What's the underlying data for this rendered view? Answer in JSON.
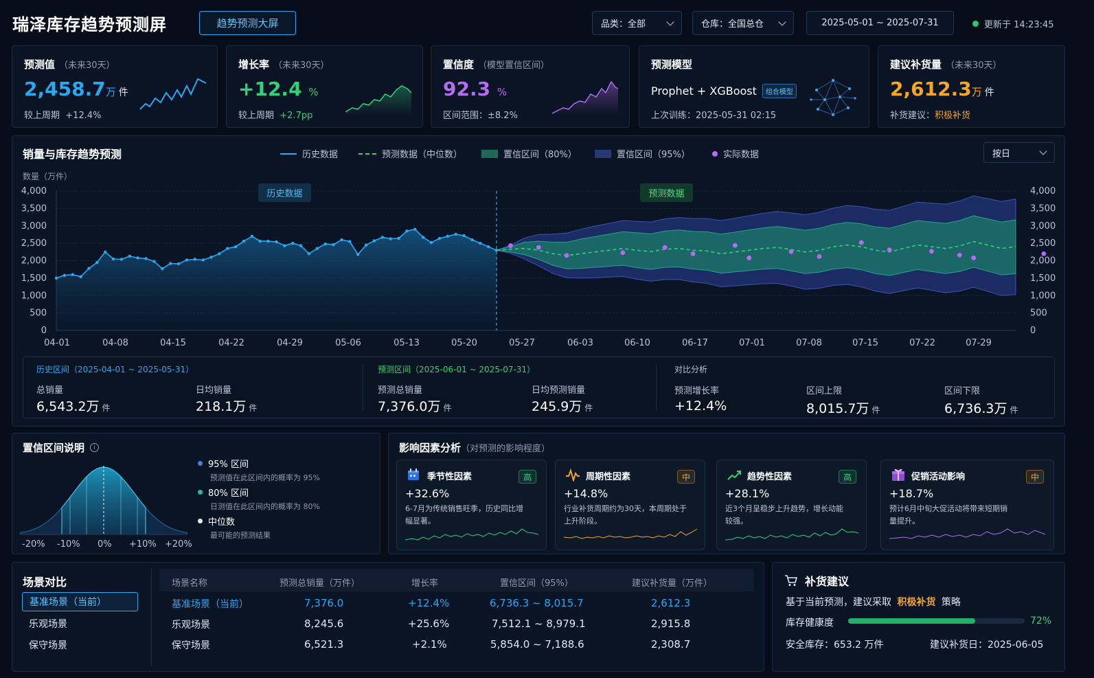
{
  "header": {
    "title": "瑞泽库存趋势预测屏",
    "badge": "趋势预测大屏",
    "category_select": "品类：全部",
    "warehouse_select": "仓库：全国总仓",
    "date_range": "2025-05-01 ~ 2025-07-31",
    "updated": "更新于 14:23:45"
  },
  "kpis": [
    {
      "title": "预测值",
      "sub": "（未来30天）",
      "value": "2,458.7",
      "unit": "万",
      "unit2": "件",
      "foot_label": "较上周期",
      "foot_value": "+12.4%"
    },
    {
      "title": "增长率",
      "sub": "（未来30天）",
      "value": "+12.4",
      "unit": "%",
      "foot_label": "较上周期",
      "foot_value": "+2.7pp"
    },
    {
      "title": "置信度",
      "sub": "（模型置信区间）",
      "value": "92.3",
      "unit": "%",
      "foot_label": "区间范围：",
      "foot_value": "±8.2%"
    },
    {
      "title": "预测模型",
      "model": "Prophet + XGBoost",
      "model_badge": "组合模型",
      "foot_label": "上次训练：",
      "foot_value": "2025-05-31 02:15"
    },
    {
      "title": "建议补货量",
      "sub": "（未来30天）",
      "value": "2,612.3",
      "unit": "万",
      "unit2": "件",
      "foot_label": "补货建议：",
      "foot_value": "积极补货"
    }
  ],
  "chart": {
    "title": "销量与库存趋势预测",
    "y_unit": "数量（万件）",
    "legend": [
      "历史数据",
      "预测数据（中位数）",
      "置信区间（80%）",
      "置信区间（95%）",
      "实际数据"
    ],
    "granularity": "按日",
    "tag_history": "历史数据",
    "tag_forecast": "预测数据"
  },
  "chart_data": {
    "type": "line",
    "x_ticks": [
      "04-01",
      "04-08",
      "04-15",
      "04-22",
      "04-29",
      "05-06",
      "05-13",
      "05-20",
      "05-27",
      "06-03",
      "06-10",
      "06-17",
      "07-01",
      "07-08",
      "07-15",
      "07-22",
      "07-29"
    ],
    "ylim": [
      0,
      4000
    ],
    "y_ticks": [
      0,
      500,
      "1,000",
      "1,500",
      "2,000",
      "2,500",
      "3,000",
      "3,500",
      "4,000"
    ],
    "history": [
      1500,
      1580,
      1600,
      1540,
      1780,
      1950,
      2250,
      2050,
      2040,
      2130,
      2080,
      2060,
      1980,
      1770,
      1920,
      1910,
      2020,
      2040,
      2020,
      2100,
      2200,
      2350,
      2400,
      2560,
      2700,
      2560,
      2560,
      2540,
      2430,
      2500,
      2430,
      2200,
      2350,
      2480,
      2460,
      2600,
      2550,
      2180,
      2450,
      2570,
      2670,
      2630,
      2640,
      2850,
      2900,
      2670,
      2520,
      2640,
      2700,
      2760,
      2720,
      2600,
      2500,
      2400,
      2300
    ],
    "forecast_median": [
      2300,
      2330,
      2350,
      2300,
      2200,
      2150,
      2200,
      2250,
      2300,
      2350,
      2300,
      2260,
      2330,
      2350,
      2300,
      2280,
      2200,
      2250,
      2300,
      2350,
      2380,
      2320,
      2250,
      2300,
      2400,
      2450,
      2400,
      2300,
      2250,
      2350,
      2450,
      2400,
      2350,
      2420,
      2550,
      2450,
      2350,
      2400
    ],
    "ci80_half": [
      0,
      80,
      180,
      260,
      330,
      380,
      420,
      440,
      460,
      480,
      500,
      510,
      520,
      530,
      540,
      550,
      560,
      570,
      580,
      590,
      600,
      610,
      620,
      630,
      640,
      650,
      660,
      670,
      680,
      690,
      700,
      710,
      720,
      730,
      740,
      750,
      760,
      770
    ],
    "ci95_half": [
      0,
      120,
      300,
      450,
      560,
      640,
      700,
      740,
      770,
      800,
      830,
      850,
      870,
      890,
      910,
      930,
      950,
      970,
      990,
      1010,
      1030,
      1050,
      1070,
      1090,
      1110,
      1130,
      1150,
      1170,
      1190,
      1210,
      1230,
      1250,
      1270,
      1290,
      1310,
      1330,
      1350,
      1370
    ],
    "actual": [
      [
        1,
        2430
      ],
      [
        3,
        2380
      ],
      [
        5,
        2150
      ],
      [
        9,
        2230
      ],
      [
        12,
        2380
      ],
      [
        14,
        2200
      ],
      [
        17,
        2440
      ],
      [
        18,
        2080
      ],
      [
        21,
        2260
      ],
      [
        23,
        2120
      ],
      [
        26,
        2520
      ],
      [
        28,
        2310
      ],
      [
        31,
        2270
      ],
      [
        33,
        2160
      ],
      [
        34,
        2080
      ],
      [
        39,
        2200
      ],
      [
        42,
        1710
      ],
      [
        46,
        2480
      ],
      [
        48,
        2050
      ],
      [
        52,
        2020
      ],
      [
        53,
        1890
      ],
      [
        55,
        2260
      ],
      [
        56,
        2140
      ]
    ]
  },
  "summary": {
    "history_title": "历史区间（2025-04-01 ~ 2025-05-31）",
    "history_total_label": "总销量",
    "history_total": "6,543.2万",
    "unit": "件",
    "history_daily_label": "日均销量",
    "history_daily": "218.1万",
    "forecast_title": "预测区间（2025-06-01 ~ 2025-07-31）",
    "forecast_total_label": "预测总销量",
    "forecast_total": "7,376.0万",
    "forecast_daily_label": "日均预测销量",
    "forecast_daily": "245.9万",
    "compare_title": "对比分析",
    "growth_label": "预测增长率",
    "growth": "+12.4%",
    "upper_label": "区间上限",
    "upper": "8,015.7万",
    "lower_label": "区间下限",
    "lower": "6,736.3万"
  },
  "confidence": {
    "title": "置信区间说明",
    "items": [
      {
        "label": "95% 区间",
        "desc": "预测值在此区间内的概率为 95%",
        "color": "#4a7de0"
      },
      {
        "label": "80% 区间",
        "desc": "日测值在此区间内的概率为 80%",
        "color": "#22c08a"
      },
      {
        "label": "中位数",
        "desc": "最可能的预测结果",
        "color": "#d4f5e6"
      }
    ],
    "x_ticks": [
      "-20%",
      "-10%",
      "0%",
      "+10%",
      "+20%"
    ]
  },
  "factors": {
    "title": "影响因素分析",
    "sub": "（对预测的影响程度）",
    "items": [
      {
        "name": "季节性因素",
        "level": "高",
        "value": "+32.6%",
        "desc": "6-7月为传统销售旺季，历史同比增幅显著。",
        "color": "#33d17a",
        "icon": "calendar-icon"
      },
      {
        "name": "周期性因素",
        "level": "中",
        "value": "+14.8%",
        "desc": "行业补货周期约为30天，本周期处于上升阶段。",
        "color": "#f5a623",
        "icon": "pulse-icon"
      },
      {
        "name": "趋势性因素",
        "level": "高",
        "value": "+28.1%",
        "desc": "近3个月呈稳步上升趋势，增长动能较强。",
        "color": "#33d17a",
        "icon": "trend-icon"
      },
      {
        "name": "促销活动影响",
        "level": "中",
        "value": "+18.7%",
        "desc": "预计6月中旬大促活动将带来短期销量提升。",
        "color": "#b46cf0",
        "icon": "gift-icon"
      }
    ]
  },
  "scenarios": {
    "title": "场景对比",
    "tabs": [
      "基准场景（当前）",
      "乐观场景",
      "保守场景"
    ],
    "columns": [
      "场景名称",
      "预测总销量（万件）",
      "增长率",
      "置信区间（95%）",
      "建议补货量（万件）"
    ],
    "rows": [
      [
        "基准场景（当前）",
        "7,376.0",
        "+12.4%",
        "6,736.3 ~ 8,015.7",
        "2,612.3"
      ],
      [
        "乐观场景",
        "8,245.6",
        "+25.6%",
        "7,512.1 ~ 8,979.1",
        "2,915.8"
      ],
      [
        "保守场景",
        "6,521.3",
        "+2.1%",
        "5,854.0 ~ 7,188.6",
        "2,308.7"
      ]
    ]
  },
  "replenish": {
    "title": "补货建议",
    "text_prefix": "基于当前预测，建议采取",
    "text_strong": "积极补货",
    "text_suffix": "策略",
    "health_label": "库存健康度",
    "health_pct": "72%",
    "health_value": 0.72,
    "safety": "安全库存：653.2 万件",
    "date": "建议补货日：2025-06-05"
  }
}
